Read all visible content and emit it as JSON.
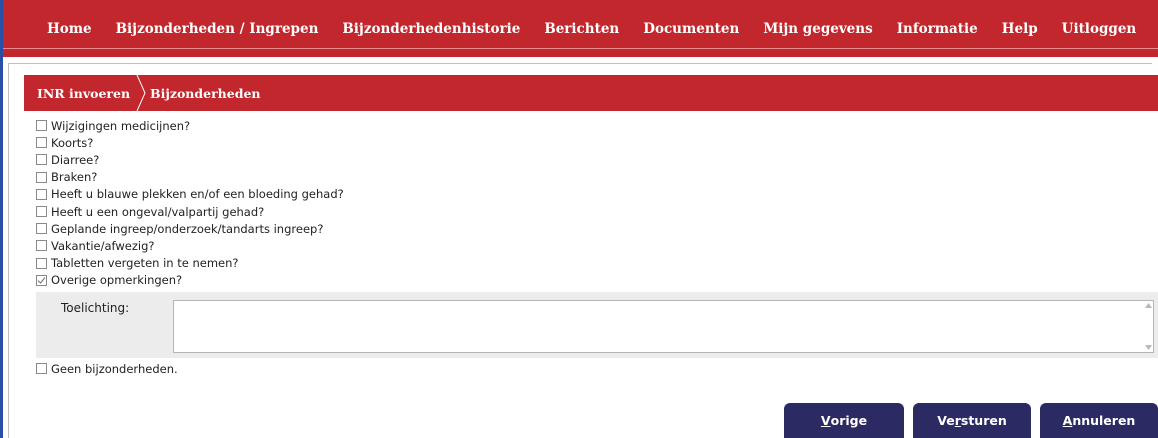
{
  "nav": {
    "items": [
      "Home",
      "Bijzonderheden / Ingrepen",
      "Bijzonderhedenhistorie",
      "Berichten",
      "Documenten",
      "Mijn gegevens",
      "Informatie",
      "Help",
      "Uitloggen"
    ]
  },
  "breadcrumb": {
    "step1": "INR invoeren",
    "step2": "Bijzonderheden"
  },
  "questions": [
    {
      "label": "Wijzigingen medicijnen?",
      "checked": false
    },
    {
      "label": "Koorts?",
      "checked": false
    },
    {
      "label": "Diarree?",
      "checked": false
    },
    {
      "label": "Braken?",
      "checked": false
    },
    {
      "label": "Heeft u blauwe plekken en/of een bloeding gehad?",
      "checked": false
    },
    {
      "label": "Heeft u een ongeval/valpartij gehad?",
      "checked": false
    },
    {
      "label": "Geplande ingreep/onderzoek/tandarts ingreep?",
      "checked": false
    },
    {
      "label": "Vakantie/afwezig?",
      "checked": false
    },
    {
      "label": "Tabletten vergeten in te nemen?",
      "checked": false
    },
    {
      "label": "Overige opmerkingen?",
      "checked": true
    }
  ],
  "toelichting": {
    "label": "Toelichting:",
    "value": ""
  },
  "geen": {
    "label": "Geen bijzonderheden.",
    "checked": false
  },
  "buttons": {
    "vorige": {
      "first": "V",
      "rest": "orige"
    },
    "versturen": {
      "first": "Ve",
      "mid": "r",
      "rest": "sturen"
    },
    "annuleren": {
      "first": "A",
      "rest": "nnuleren"
    }
  },
  "colors": {
    "brand_red": "#c1272d",
    "button_navy": "#2c2a63",
    "frame_blue": "#2a4fa6"
  }
}
